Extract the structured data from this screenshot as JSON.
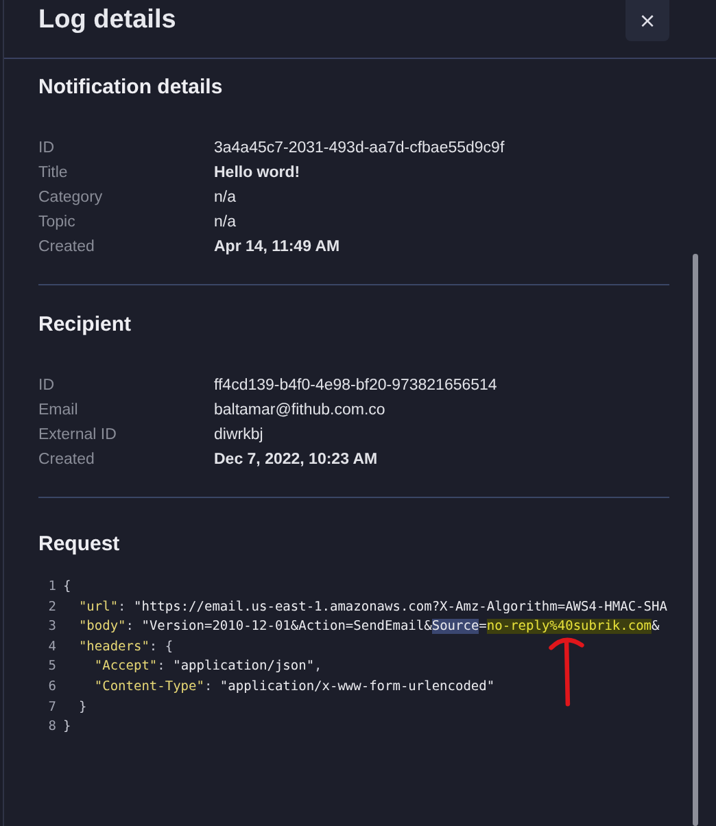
{
  "header": {
    "title": "Log details",
    "close": "×"
  },
  "sections": [
    {
      "title": "Notification details",
      "rows": [
        {
          "label": "ID",
          "value": "3a4a45c7-2031-493d-aa7d-cfbae55d9c9f",
          "strong": false
        },
        {
          "label": "Title",
          "value": "Hello word!",
          "strong": true
        },
        {
          "label": "Category",
          "value": "n/a",
          "strong": false
        },
        {
          "label": "Topic",
          "value": "n/a",
          "strong": false
        },
        {
          "label": "Created",
          "value": "Apr 14, 11:49 AM",
          "strong": true
        }
      ]
    },
    {
      "title": "Recipient",
      "rows": [
        {
          "label": "ID",
          "value": "ff4cd139-b4f0-4e98-bf20-973821656514",
          "strong": false
        },
        {
          "label": "Email",
          "value": "baltamar@fithub.com.co",
          "strong": false
        },
        {
          "label": "External ID",
          "value": "diwrkbj",
          "strong": false
        },
        {
          "label": "Created",
          "value": "Dec 7, 2022, 10:23 AM",
          "strong": true
        }
      ]
    }
  ],
  "request": {
    "title": "Request",
    "lines": [
      {
        "number": "1",
        "segments": [
          {
            "text": "{",
            "kind": "punct"
          }
        ]
      },
      {
        "number": "2",
        "segments": [
          {
            "text": "  \"url\"",
            "kind": "key"
          },
          {
            "text": ": ",
            "kind": "punct"
          },
          {
            "text": "\"https://email.us-east-1.amazonaws.com?X-Amz-Algorithm=AWS4-HMAC-SHA",
            "kind": "str"
          }
        ]
      },
      {
        "number": "3",
        "segments": [
          {
            "text": "  \"body\"",
            "kind": "key"
          },
          {
            "text": ": ",
            "kind": "punct"
          },
          {
            "text": "\"Version=2010-12-01&Action=SendEmail&",
            "kind": "str"
          },
          {
            "text": "Source",
            "kind": "selected"
          },
          {
            "text": "=",
            "kind": "str"
          },
          {
            "text": "no-reply%40subrik.com",
            "kind": "marked"
          },
          {
            "text": "&",
            "kind": "str"
          }
        ]
      },
      {
        "number": "4",
        "segments": [
          {
            "text": "  \"headers\"",
            "kind": "key"
          },
          {
            "text": ": {",
            "kind": "punct"
          }
        ]
      },
      {
        "number": "5",
        "segments": [
          {
            "text": "    \"Accept\"",
            "kind": "key"
          },
          {
            "text": ": ",
            "kind": "punct"
          },
          {
            "text": "\"application/json\"",
            "kind": "str"
          },
          {
            "text": ",",
            "kind": "punct"
          }
        ]
      },
      {
        "number": "6",
        "segments": [
          {
            "text": "    \"Content-Type\"",
            "kind": "key"
          },
          {
            "text": ": ",
            "kind": "punct"
          },
          {
            "text": "\"application/x-www-form-urlencoded\"",
            "kind": "str"
          }
        ]
      },
      {
        "number": "7",
        "segments": [
          {
            "text": "  }",
            "kind": "punct"
          }
        ]
      },
      {
        "number": "8",
        "segments": [
          {
            "text": "}",
            "kind": "punct"
          }
        ]
      }
    ]
  },
  "annotations": [
    {
      "kind": "arrow"
    }
  ]
}
